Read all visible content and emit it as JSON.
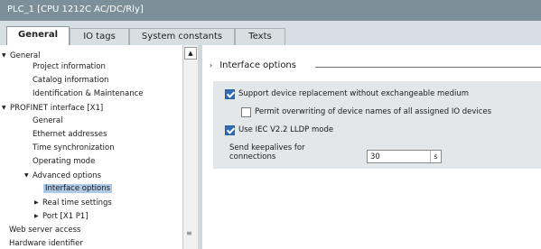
{
  "window": {
    "title": "PLC_1 [CPU 1212C AC/DC/Rly]"
  },
  "tabs": [
    {
      "label": "General",
      "active": true
    },
    {
      "label": "IO tags",
      "active": false
    },
    {
      "label": "System constants",
      "active": false
    },
    {
      "label": "Texts",
      "active": false
    }
  ],
  "tree": [
    {
      "label": "General",
      "expander": "expanded"
    },
    {
      "label": "Project information"
    },
    {
      "label": "Catalog information"
    },
    {
      "label": "Identification & Maintenance"
    },
    {
      "label": "PROFINET interface [X1]",
      "expander": "expanded"
    },
    {
      "label": "General"
    },
    {
      "label": "Ethernet addresses"
    },
    {
      "label": "Time synchronization"
    },
    {
      "label": "Operating mode"
    },
    {
      "label": "Advanced options",
      "expander": "expanded"
    },
    {
      "label": "Interface options",
      "selected": true
    },
    {
      "label": "Real time settings",
      "expander": "collapsed"
    },
    {
      "label": "Port [X1 P1]",
      "expander": "collapsed"
    },
    {
      "label": "Web server access"
    },
    {
      "label": "Hardware identifier"
    }
  ],
  "section": {
    "title": "Interface options"
  },
  "options": {
    "support_replacement": {
      "label": "Support device replacement without exchangeable medium",
      "checked": true
    },
    "permit_overwrite": {
      "label": "Permit overwriting of device names of all assigned IO devices",
      "checked": false
    },
    "use_lldp": {
      "label": "Use IEC V2.2 LLDP mode",
      "checked": true
    }
  },
  "keepalive": {
    "label_line1": "Send keepalives for",
    "label_line2": "connections",
    "value": "30",
    "unit": "s"
  },
  "colors": {
    "titlebar": "#7d909a",
    "tabstrip": "#d6dfe4",
    "panel": "#e3e7ea",
    "selection": "#aec9e6",
    "checkbox_checked": "#2f6db5"
  },
  "icons": {
    "expanded": "triangle-down-icon",
    "collapsed": "triangle-right-icon",
    "section": "chevron-right-icon"
  }
}
